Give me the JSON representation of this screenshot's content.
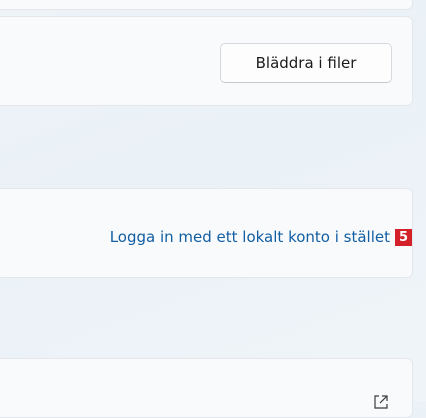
{
  "browse_section": {
    "button_label": "Bläddra i filer"
  },
  "login_section": {
    "link_label": "Logga in med ett lokalt konto i stället",
    "marker": "5"
  },
  "bottom_section": {
    "icon": "external-link-icon"
  },
  "colors": {
    "link": "#115ea3",
    "marker": "#d32029",
    "card": "#f9fafc"
  }
}
